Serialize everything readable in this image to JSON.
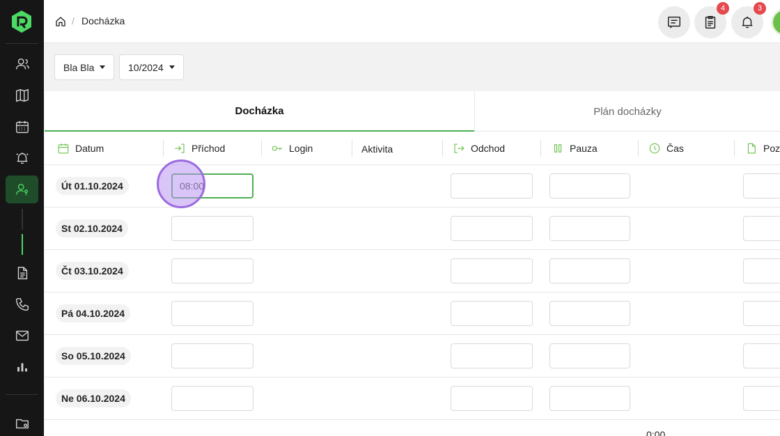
{
  "breadcrumb": {
    "current": "Docházka"
  },
  "topbar": {
    "messages_badge": "",
    "tasks_badge": "4",
    "notifications_badge": "3"
  },
  "filters": {
    "employee": "Bla Bla",
    "period": "10/2024"
  },
  "tabs": [
    {
      "label": "Docházka"
    },
    {
      "label": "Plán docházky"
    }
  ],
  "columns": {
    "datum": "Datum",
    "prichod": "Příchod",
    "login": "Login",
    "aktivita": "Aktivita",
    "odchod": "Odchod",
    "pauza": "Pauza",
    "cas": "Čas",
    "poz": "Poz"
  },
  "rows": [
    {
      "date": "Út 01.10.2024",
      "prichod": "08:00"
    },
    {
      "date": "St 02.10.2024",
      "prichod": ""
    },
    {
      "date": "Čt 03.10.2024",
      "prichod": ""
    },
    {
      "date": "Pá 04.10.2024",
      "prichod": ""
    },
    {
      "date": "So 05.10.2024",
      "prichod": ""
    },
    {
      "date": "Ne 06.10.2024",
      "prichod": ""
    }
  ],
  "total_time": "0:00",
  "colors": {
    "accent": "#4caf50",
    "sidebar": "#161616",
    "badge": "#e5484d"
  },
  "icons": [
    "users-icon",
    "map-icon",
    "calendar-icon",
    "alarm-icon",
    "attendance-icon",
    "document-icon",
    "phone-icon",
    "mail-icon",
    "chart-icon",
    "folder-settings-icon"
  ]
}
